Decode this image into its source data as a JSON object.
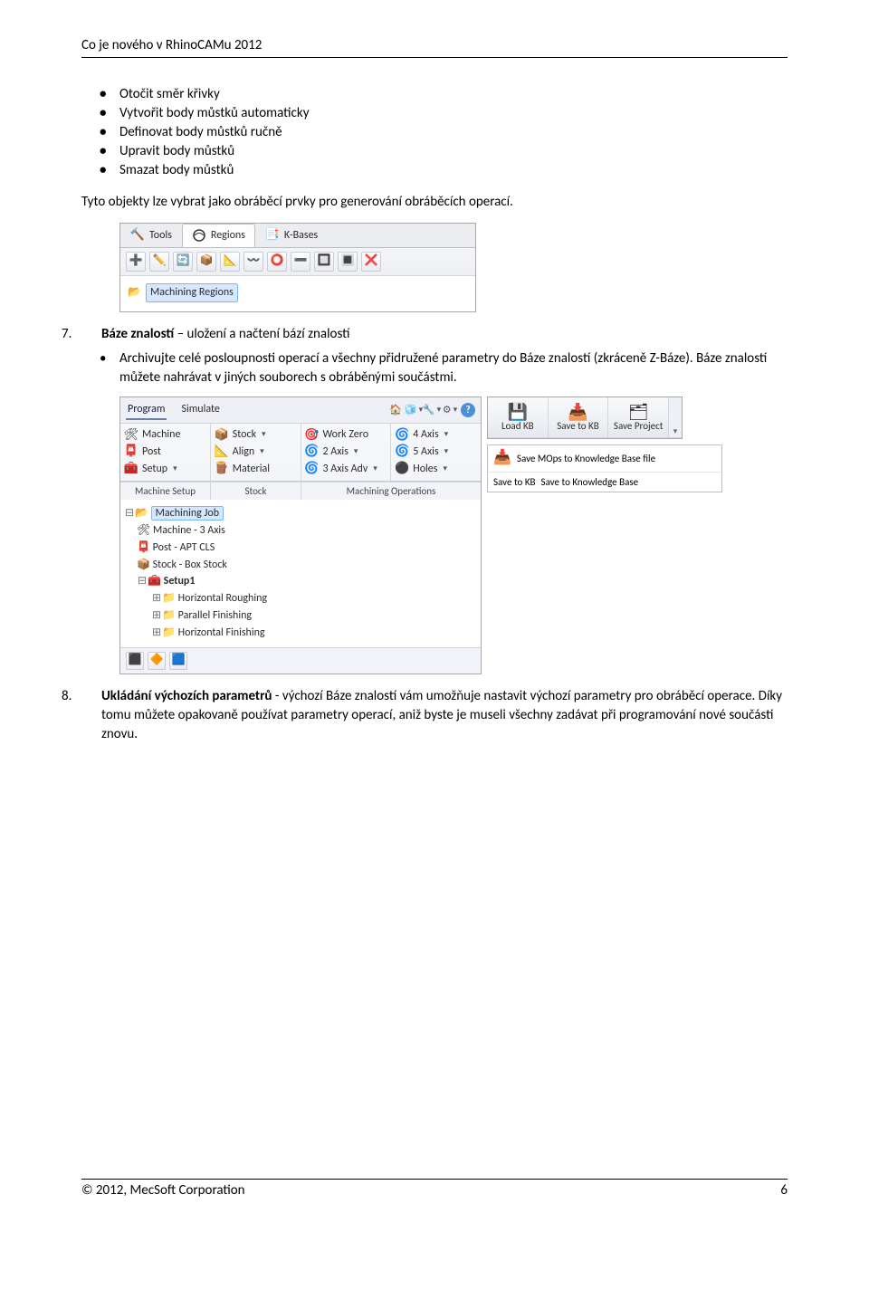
{
  "header": "Co je nového v RhinoCAMu 2012",
  "footer_left": "© 2012, MecSoft Corporation",
  "footer_right": "6",
  "bullets_top": [
    "Otočit směr křivky",
    "Vytvořit body můstků automaticky",
    "Definovat body můstků ručně",
    "Upravit body můstků",
    "Smazat body můstků"
  ],
  "para1": "Tyto objekty lze vybrat jako obráběcí prvky pro generování obráběcích operací.",
  "image1": {
    "tabs": {
      "tools": "Tools",
      "regions": "Regions",
      "kbases": "K-Bases"
    },
    "tree_item": "Machining Regions"
  },
  "sec7_num": "7.",
  "sec7_title_bold": "Báze znalostí",
  "sec7_title_rest": " – uložení a načtení bází znalostí",
  "sec7_bullet": "Archivujte celé posloupnosti operací a všechny přidružené parametry do Báze znalostí (zkráceně Z-Báze). Báze znalostí můžete nahrávat v jiných souborech s obráběnými součástmi.",
  "image2": {
    "top_tabs": {
      "program": "Program",
      "simulate": "Simulate"
    },
    "groups": {
      "machine_setup": "Machine Setup",
      "stock": "Stock",
      "machining_ops": "Machining Operations"
    },
    "col1": {
      "machine": "Machine",
      "post": "Post",
      "setup": "Setup"
    },
    "col2": {
      "stock": "Stock",
      "align": "Align",
      "material": "Material"
    },
    "col3": {
      "workzero": "Work Zero",
      "axis2": "2 Axis",
      "axis3adv": "3 Axis Adv"
    },
    "col4": {
      "axis4": "4 Axis",
      "axis5": "5 Axis",
      "holes": "Holes"
    },
    "tree": {
      "job": "Machining Job",
      "machine3": "Machine - 3 Axis",
      "post_apt": "Post - APT CLS",
      "stockbox": "Stock - Box Stock",
      "setup1": "Setup1",
      "hrough": "Horizontal Roughing",
      "pfin": "Parallel Finishing",
      "hfin": "Horizontal Finishing"
    },
    "kb": {
      "load": "Load KB",
      "save": "Save to KB",
      "project": "Save Project"
    },
    "tooltip": {
      "row1_label": "Save to KB",
      "row1_text": "Save MOps to Knowledge Base file",
      "row2_text": "Save to Knowledge Base"
    }
  },
  "sec8_num": "8.",
  "sec8_bold": "Ukládání výchozích parametrů",
  "sec8_rest": " - výchozí Báze znalostí vám umožňuje nastavit výchozí parametry pro obráběcí operace. Díky tomu můžete opakovaně používat parametry operací, aniž byste je museli všechny zadávat při programování nové součásti znovu."
}
